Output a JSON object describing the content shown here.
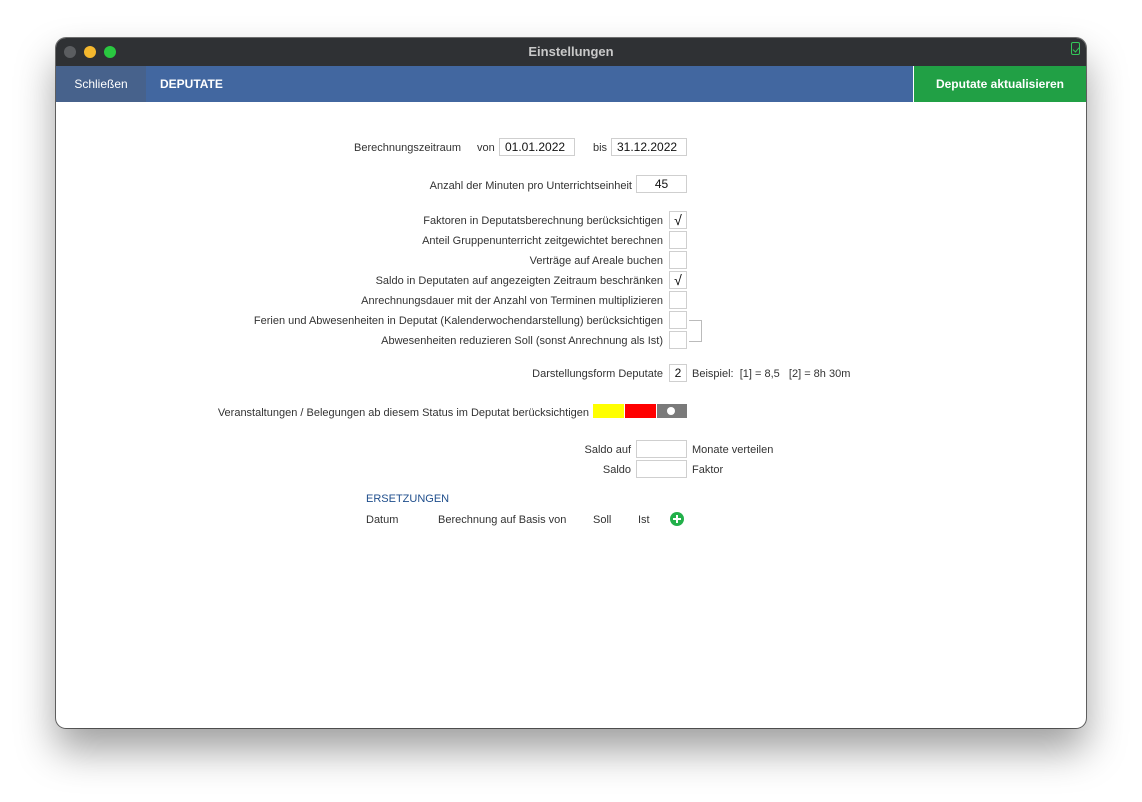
{
  "window": {
    "title": "Einstellungen"
  },
  "toolbar": {
    "close_label": "Schließen",
    "section_label": "DEPUTATE",
    "update_label": "Deputate aktualisieren"
  },
  "period": {
    "label": "Berechnungszeitraum",
    "from_label": "von",
    "from_value": "01.01.2022",
    "to_label": "bis",
    "to_value": "31.12.2022"
  },
  "minutes": {
    "label": "Anzahl der Minuten pro Unterrichtseinheit",
    "value": "45"
  },
  "options": [
    {
      "label": "Faktoren in Deputatsberechnung berücksichtigen",
      "checked": true
    },
    {
      "label": "Anteil Gruppenunterricht zeitgewichtet berechnen",
      "checked": false
    },
    {
      "label": "Verträge auf Areale buchen",
      "checked": false
    },
    {
      "label": "Saldo in Deputaten auf angezeigten Zeitraum beschränken",
      "checked": true
    },
    {
      "label": "Anrechnungsdauer mit der Anzahl von Terminen multiplizieren",
      "checked": false
    },
    {
      "label": "Ferien und Abwesenheiten in Deputat (Kalenderwochendarstellung) berücksichtigen",
      "checked": false
    },
    {
      "label": "Abwesenheiten reduzieren Soll (sonst Anrechnung als Ist)",
      "checked": false
    }
  ],
  "check_mark": "√",
  "display_form": {
    "label": "Darstellungsform Deputate",
    "value": "2",
    "example": "Beispiel:  [1] = 8,5   [2] = 8h 30m"
  },
  "status": {
    "label": "Veranstaltungen / Belegungen ab diesem Status im Deputat berücksichtigen",
    "colors": [
      "#ffff00",
      "#ff0000",
      "#7a7a7a"
    ]
  },
  "saldo": {
    "distribute_label": "Saldo auf",
    "distribute_value": "",
    "distribute_suffix": "Monate verteilen",
    "factor_label": "Saldo",
    "factor_value": "",
    "factor_suffix": "Faktor"
  },
  "replacements": {
    "title": "ERSETZUNGEN",
    "columns": [
      "Datum",
      "Berechnung auf Basis von",
      "Soll",
      "Ist"
    ]
  }
}
